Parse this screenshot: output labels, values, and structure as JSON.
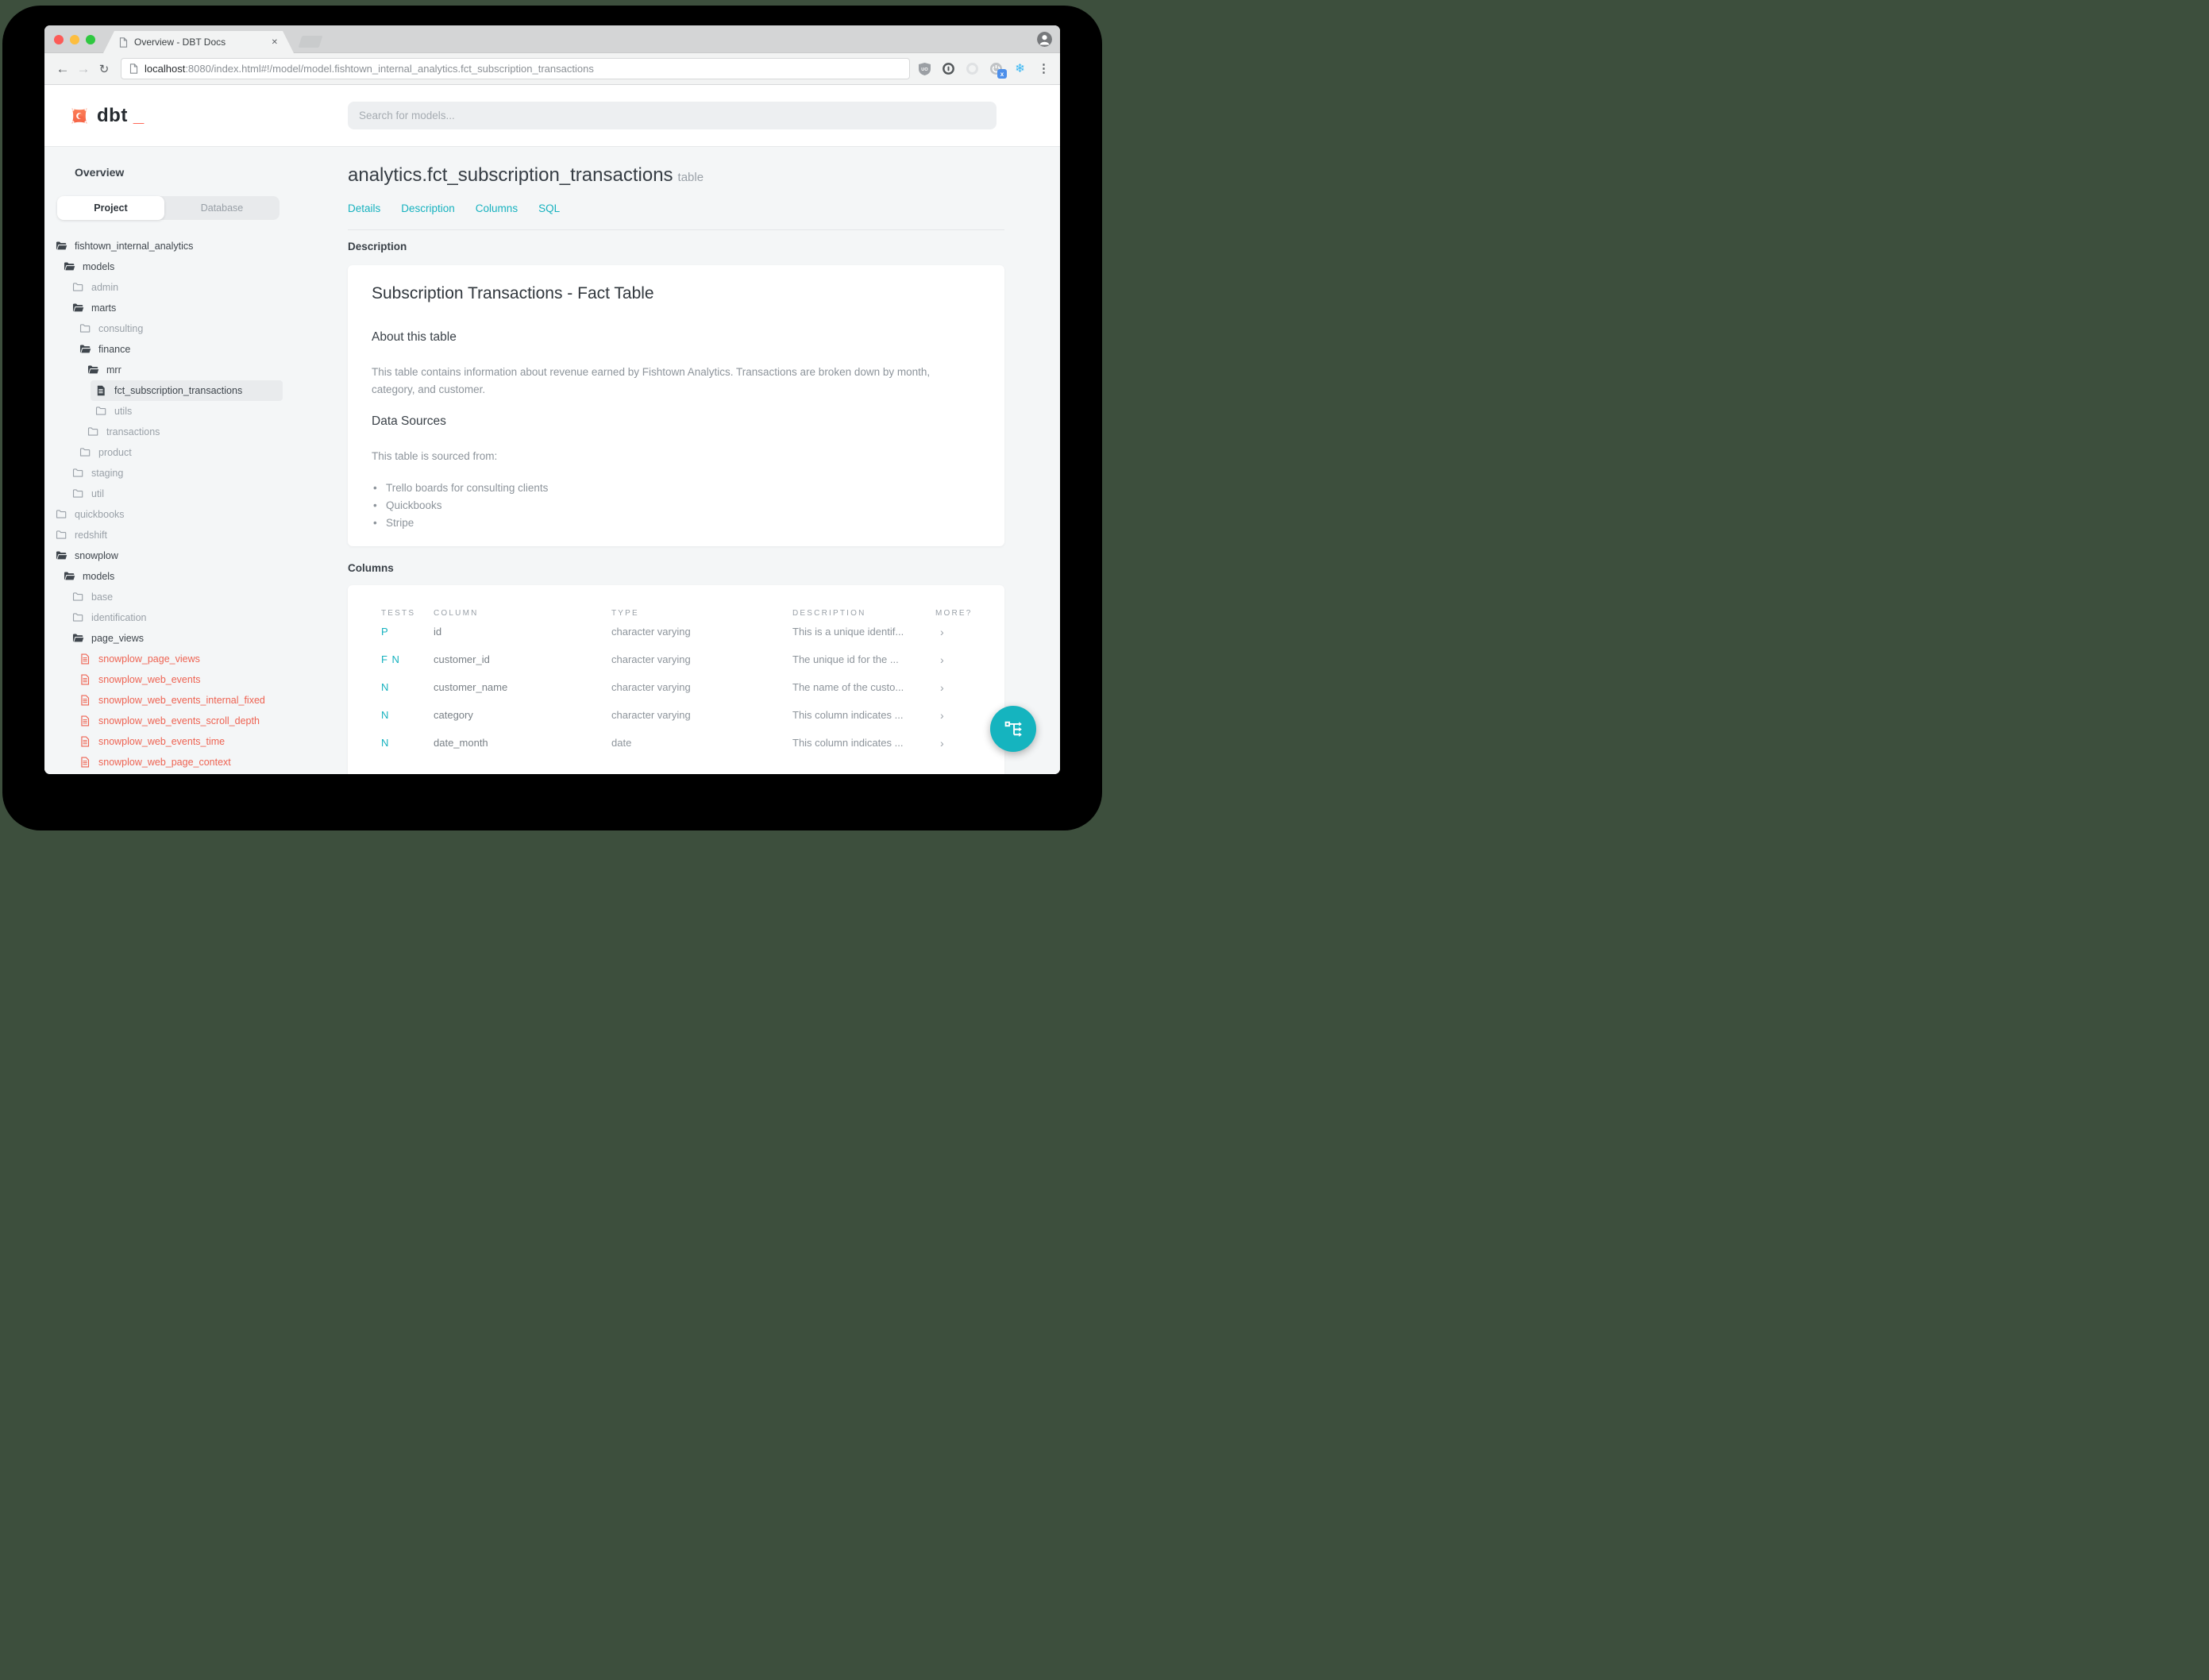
{
  "browser": {
    "tab_title": "Overview - DBT Docs",
    "close_glyph": "✕",
    "back_glyph": "←",
    "forward_glyph": "→",
    "reload_glyph": "↻",
    "url_host": "localhost",
    "url_path": ":8080/index.html#!/model/model.fishtown_internal_analytics.fct_subscription_transactions",
    "extensions": {
      "ublock_label": "UO",
      "badge_x": "x",
      "snowflake_glyph": "❄",
      "menu_glyph": "⋮"
    }
  },
  "header": {
    "logo_text": "dbt",
    "logo_cursor": "_",
    "search_placeholder": "Search for models..."
  },
  "sidebar": {
    "heading": "Overview",
    "tabs": [
      {
        "label": "Project"
      },
      {
        "label": "Database"
      }
    ],
    "tree": [
      {
        "label": "fishtown_internal_analytics"
      },
      {
        "label": "models"
      },
      {
        "label": "admin"
      },
      {
        "label": "marts"
      },
      {
        "label": "consulting"
      },
      {
        "label": "finance"
      },
      {
        "label": "mrr"
      },
      {
        "label": "fct_subscription_transactions"
      },
      {
        "label": "utils"
      },
      {
        "label": "transactions"
      },
      {
        "label": "product"
      },
      {
        "label": "staging"
      },
      {
        "label": "util"
      },
      {
        "label": "quickbooks"
      },
      {
        "label": "redshift"
      },
      {
        "label": "snowplow"
      },
      {
        "label": "models"
      },
      {
        "label": "base"
      },
      {
        "label": "identification"
      },
      {
        "label": "page_views"
      },
      {
        "label": "snowplow_page_views"
      },
      {
        "label": "snowplow_web_events"
      },
      {
        "label": "snowplow_web_events_internal_fixed"
      },
      {
        "label": "snowplow_web_events_scroll_depth"
      },
      {
        "label": "snowplow_web_events_time"
      },
      {
        "label": "snowplow_web_page_context"
      }
    ]
  },
  "main": {
    "title": "analytics.fct_subscription_transactions",
    "title_badge": "table",
    "nav": [
      {
        "label": "Details"
      },
      {
        "label": "Description"
      },
      {
        "label": "Columns"
      },
      {
        "label": "SQL"
      }
    ],
    "description_heading": "Description",
    "doc": {
      "title": "Subscription Transactions - Fact Table",
      "about_heading": "About this table",
      "about_text": "This table contains information about revenue earned by Fishtown Analytics. Transactions are broken down by month, category, and customer.",
      "sources_heading": "Data Sources",
      "sources_intro": "This table is sourced from:",
      "sources": [
        "Trello boards for consulting clients",
        "Quickbooks",
        "Stripe"
      ]
    },
    "columns_heading": "Columns",
    "table": {
      "headers": [
        "TESTS",
        "COLUMN",
        "TYPE",
        "DESCRIPTION",
        "MORE?"
      ],
      "rows": [
        {
          "tests": "P",
          "column": "id",
          "type": "character varying",
          "description": "This is a unique identif...",
          "more": "›"
        },
        {
          "tests": "F N",
          "column": "customer_id",
          "type": "character varying",
          "description": "The unique id for the ...",
          "more": "›"
        },
        {
          "tests": "N",
          "column": "customer_name",
          "type": "character varying",
          "description": "The name of the custo...",
          "more": "›"
        },
        {
          "tests": "N",
          "column": "category",
          "type": "character varying",
          "description": "This column indicates ...",
          "more": "›"
        },
        {
          "tests": "N",
          "column": "date_month",
          "type": "date",
          "description": "This column indicates ...",
          "more": "›"
        }
      ]
    }
  },
  "colors": {
    "accent_teal": "#16b2bf",
    "coral": "#ee6352",
    "logo_orange": "#ff5c4a"
  }
}
